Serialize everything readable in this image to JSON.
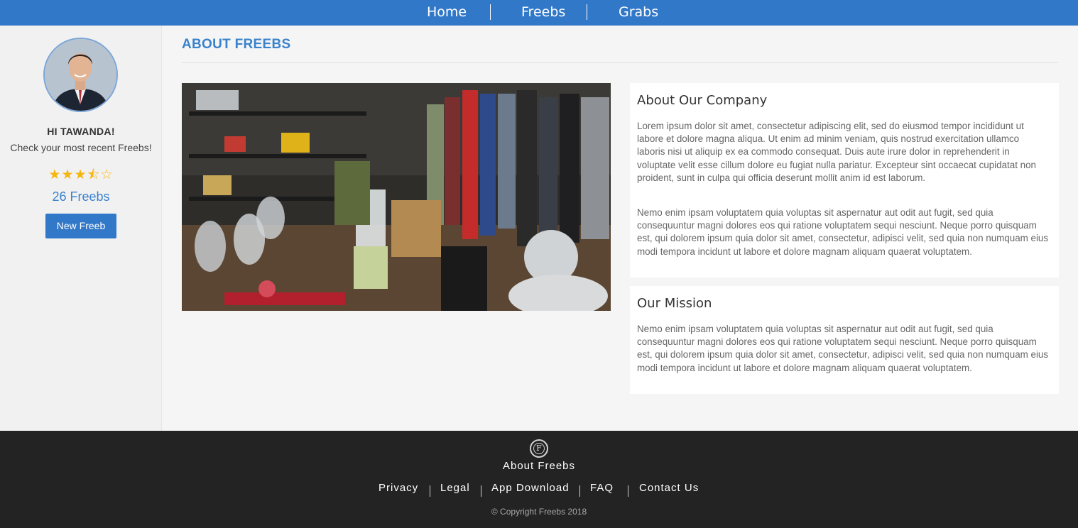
{
  "nav": {
    "items": [
      {
        "label": "Home"
      },
      {
        "label": "Freebs"
      },
      {
        "label": "Grabs"
      }
    ]
  },
  "sidebar": {
    "greeting": "HI TAWANDA!",
    "subtitle": "Check your most recent Freebs!",
    "rating": 3.5,
    "rating_max": 5,
    "stars_text": "★★★⯪☆",
    "freeb_count": "26 Freebs",
    "new_button": "New Freeb"
  },
  "main": {
    "page_title": "ABOUT FREEBS",
    "about": {
      "heading": "About Our Company",
      "p1": "Lorem ipsum dolor sit amet, consectetur adipiscing elit, sed do eiusmod tempor incididunt ut labore et dolore magna aliqua. Ut enim ad minim veniam, quis nostrud exercitation ullamco laboris nisi ut aliquip ex ea commodo consequat. Duis aute irure dolor in reprehenderit in voluptate velit esse cillum dolore eu fugiat nulla pariatur. Excepteur sint occaecat cupidatat non proident, sunt in culpa qui officia deserunt mollit anim id est laborum.",
      "p2": "Nemo enim ipsam voluptatem quia voluptas sit aspernatur aut odit aut fugit, sed quia consequuntur magni dolores eos qui ratione voluptatem sequi nesciunt. Neque porro quisquam est, qui dolorem ipsum quia dolor sit amet, consectetur, adipisci velit, sed quia non numquam eius modi tempora incidunt ut labore et dolore magnam aliquam quaerat voluptatem."
    },
    "mission": {
      "heading": "Our Mission",
      "p1": "Nemo enim ipsam voluptatem quia voluptas sit aspernatur aut odit aut fugit, sed quia consequuntur magni dolores eos qui ratione voluptatem sequi nesciunt. Neque porro quisquam est, qui dolorem ipsum quia dolor sit amet, consectetur, adipisci velit, sed quia non numquam eius modi tempora incidunt ut labore et dolore magnam aliquam quaerat voluptatem."
    }
  },
  "footer": {
    "logo_letter": "F",
    "title": "About Freebs",
    "links": [
      {
        "label": "Privacy"
      },
      {
        "label": "Legal"
      },
      {
        "label": "App Download"
      },
      {
        "label": "FAQ"
      },
      {
        "label": "Contact Us"
      }
    ],
    "copyright": "© Copyright Freebs 2018"
  },
  "colors": {
    "brand_blue": "#3278c8",
    "link_blue": "#3a82cc",
    "star_gold": "#f6b60f",
    "footer_bg": "#232323"
  }
}
